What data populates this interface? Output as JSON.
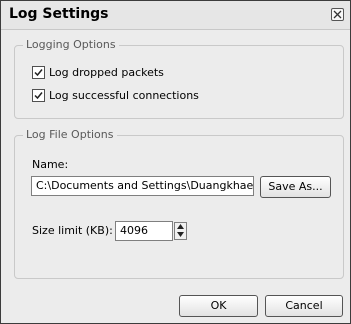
{
  "window": {
    "title": "Log Settings",
    "close_icon": "close-icon"
  },
  "logging_options": {
    "legend": "Logging Options",
    "items": [
      {
        "label": "Log dropped packets",
        "checked": true
      },
      {
        "label": "Log successful connections",
        "checked": true
      }
    ]
  },
  "log_file_options": {
    "legend": "Log File Options",
    "name_label": "Name:",
    "name_value": "C:\\Documents and Settings\\Duangkhae\\De",
    "save_as_label": "Save As...",
    "size_label": "Size limit (KB):",
    "size_value": "4096"
  },
  "buttons": {
    "ok": "OK",
    "cancel": "Cancel"
  }
}
